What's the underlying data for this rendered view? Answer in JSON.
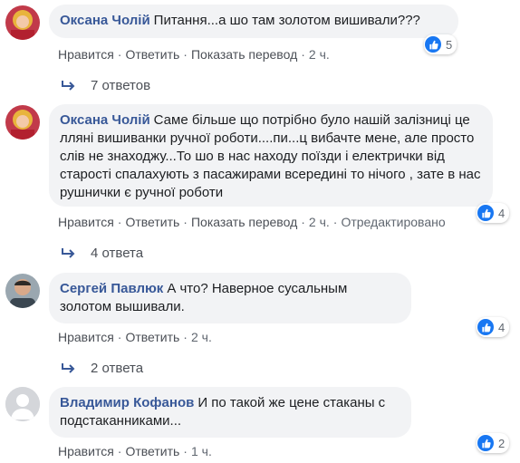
{
  "comments": [
    {
      "author": "Оксана Чолій",
      "text": "Питання...а шо там золотом вишивали???",
      "actions": {
        "like": "Нравится",
        "reply": "Ответить",
        "translate": "Показать перевод",
        "time": "2 ч."
      },
      "reactions": "5",
      "replies": "7 ответов"
    },
    {
      "author": "Оксана Чолій",
      "text": "Саме більше що потрібно було нашій залізниці це лляні вишиванки ручної роботи....пи...ц вибачте мене, але просто слів не знаходжу...То шо в нас находу поїзди і електрички від старості спалахують з пасажирами всередині то нічого , зате в нас рушнички є ручної роботи",
      "actions": {
        "like": "Нравится",
        "reply": "Ответить",
        "translate": "Показать перевод",
        "time": "2 ч.",
        "edited": "Отредактировано"
      },
      "reactions": "4",
      "replies": "4 ответа"
    },
    {
      "author": "Сергей Павлюк",
      "text": "А что? Наверное сусальным золотом вышивали.",
      "actions": {
        "like": "Нравится",
        "reply": "Ответить",
        "time": "2 ч."
      },
      "reactions": "4",
      "replies": "2 ответа"
    },
    {
      "author": "Владимир Кофанов",
      "text": "И по такой же цене стаканы с подстаканниками...",
      "actions": {
        "like": "Нравится",
        "reply": "Ответить",
        "time": "1 ч."
      },
      "reactions": "2"
    }
  ],
  "colors": {
    "author": "#385898",
    "bubble": "#f2f3f5",
    "like": "#1877f2",
    "meta": "#606770"
  },
  "icons": [
    "like-icon",
    "reply-arrow-icon",
    "avatar"
  ]
}
